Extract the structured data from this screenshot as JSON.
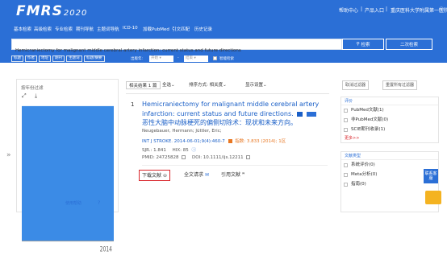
{
  "app": {
    "logo": "FMRS",
    "logo_year": "2020"
  },
  "topnav": {
    "help": "帮助中心",
    "products": "产品入口",
    "institution": "重庆医科大学附属第一医院",
    "info_icon": "info-icon"
  },
  "mainnav": {
    "items": [
      "基本检索",
      "高级检索",
      "专业检索",
      "期刊导航",
      "主题词导航",
      "ICD-10",
      "加载PubMed",
      "引文匹配",
      "历史记录"
    ]
  },
  "search": {
    "value": "Hemicraniectomy for malignant middle cerebral artery infarction: current status and future directions",
    "search_label": "检索",
    "second_label": "二次检索"
  },
  "filters": {
    "tags": [
      "标题",
      "作者",
      "地址",
      "期刊",
      "主题词",
      "标题/摘要"
    ],
    "year_label": "出版年:",
    "start_placeholder": "开始",
    "to": "-",
    "end_placeholder": "结束",
    "smart_label": "智能检索"
  },
  "left": {
    "title": "按年份过滤",
    "expand_icon": "expand-icon",
    "download_icon": "download-icon",
    "year_tick": "2014",
    "help_link": "使用帮助"
  },
  "toolbar": {
    "results": "相关结果 1 篇",
    "select_all": "全选",
    "sort": "排序方式: 相关度",
    "display": "显示设置"
  },
  "article": {
    "index": "1",
    "title": "Hemicraniectomy for malignant middle cerebral artery infarction: current status and future directions.",
    "title_cn": "恶性大脑中动脉梗死的偏侧切除术：现状和未来方向。",
    "authors": "Neugebauer, Hermann; Jüttler, Eric;",
    "journal": "INT J STROKE. 2014-06-01;9(4):460-7",
    "impact": "指数: 3.833 (2014); 1区",
    "sjr": "SJR.: 1.841",
    "hix": "HIX: 85",
    "pmid": "PMID: 24725828",
    "doi": "DOI: 10.1111/ijs.12211",
    "download": "下载文献",
    "fulltext": "全文请求",
    "cite": "引用文献"
  },
  "right": {
    "btn_filter": "取消过滤器",
    "btn_reset": "重置所有过滤器",
    "sec1_head": "评价",
    "sec1_items": [
      "PubMed文献(1)",
      "非PubMed文献(0)",
      "SCIE期刊收录(1)"
    ],
    "more": "更多>>",
    "sec2_head": "文献类型",
    "sec2_items": [
      "系统评价(0)",
      "Meta分析(0)",
      "指南(0)"
    ]
  },
  "float": {
    "service": "联系客服"
  },
  "chart_data": {
    "type": "bar",
    "categories": [
      "2014"
    ],
    "values": [
      1
    ],
    "title": "",
    "xlabel": "",
    "ylabel": "",
    "color": "#3b8be6"
  }
}
